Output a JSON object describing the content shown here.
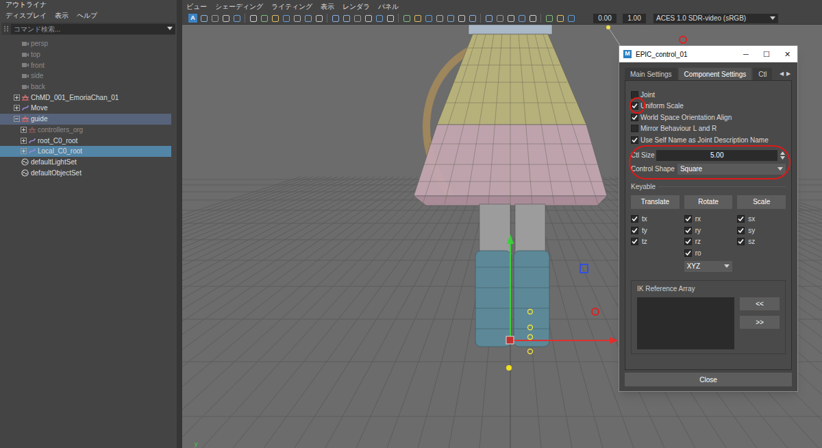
{
  "outliner": {
    "title": "アウトライナ",
    "menu": [
      "ディスプレイ",
      "表示",
      "ヘルプ"
    ],
    "search": {
      "placeholder": "コマンド検索..."
    },
    "items": [
      {
        "label": "persp",
        "kind": "camera",
        "depth": 0,
        "expandable": false,
        "expanded": false,
        "dimmed": true,
        "highlighted": false,
        "selected": false
      },
      {
        "label": "top",
        "kind": "camera",
        "depth": 0,
        "expandable": false,
        "expanded": false,
        "dimmed": true,
        "highlighted": false,
        "selected": false
      },
      {
        "label": "front",
        "kind": "camera",
        "depth": 0,
        "expandable": false,
        "expanded": false,
        "dimmed": true,
        "highlighted": false,
        "selected": false
      },
      {
        "label": "side",
        "kind": "camera",
        "depth": 0,
        "expandable": false,
        "expanded": false,
        "dimmed": true,
        "highlighted": false,
        "selected": false
      },
      {
        "label": "back",
        "kind": "camera",
        "depth": 0,
        "expandable": false,
        "expanded": false,
        "dimmed": true,
        "highlighted": false,
        "selected": false
      },
      {
        "label": "ChMD_001_EmoriaChan_01",
        "kind": "group",
        "depth": 0,
        "expandable": true,
        "expanded": false,
        "dimmed": false,
        "highlighted": false,
        "selected": false
      },
      {
        "label": "Move",
        "kind": "curve",
        "depth": 0,
        "expandable": true,
        "expanded": false,
        "dimmed": false,
        "highlighted": false,
        "selected": false
      },
      {
        "label": "guide",
        "kind": "group",
        "depth": 0,
        "expandable": true,
        "expanded": true,
        "dimmed": false,
        "highlighted": true,
        "selected": false
      },
      {
        "label": "controllers_org",
        "kind": "group",
        "depth": 1,
        "expandable": true,
        "expanded": false,
        "dimmed": true,
        "highlighted": false,
        "selected": false
      },
      {
        "label": "root_C0_root",
        "kind": "curve",
        "depth": 1,
        "expandable": true,
        "expanded": false,
        "dimmed": false,
        "highlighted": false,
        "selected": false
      },
      {
        "label": "Local_C0_root",
        "kind": "curve",
        "depth": 1,
        "expandable": true,
        "expanded": false,
        "dimmed": false,
        "highlighted": false,
        "selected": true
      },
      {
        "label": "defaultLightSet",
        "kind": "set",
        "depth": 0,
        "expandable": false,
        "expanded": false,
        "dimmed": false,
        "highlighted": false,
        "selected": false
      },
      {
        "label": "defaultObjectSet",
        "kind": "set",
        "depth": 0,
        "expandable": false,
        "expanded": false,
        "dimmed": false,
        "highlighted": false,
        "selected": false
      }
    ]
  },
  "viewport": {
    "menu": [
      "ビュー",
      "シェーディング",
      "ライティング",
      "表示",
      "レンダラ",
      "パネル"
    ],
    "toolbar_badge": "A",
    "fields": [
      "0.00",
      "1.00"
    ],
    "color_space": "ACES 1.0 SDR-video (sRGB)",
    "axis_label": "y"
  },
  "dialog": {
    "title": "EPIC_control_01",
    "app_icon": "M",
    "window_buttons": [
      "─",
      "☐",
      "✕"
    ],
    "tabs": [
      {
        "label": "Main Settings",
        "selected": false
      },
      {
        "label": "Component Settings",
        "selected": true
      },
      {
        "label": "Ctl",
        "selected": false
      }
    ],
    "tab_scroll": [
      "◀",
      "▶"
    ],
    "options": [
      {
        "label": "Joint",
        "checked": false
      },
      {
        "label": "Uniform Scale",
        "checked": true
      },
      {
        "label": "World Space Orientation Align",
        "checked": true
      },
      {
        "label": "Mirror Behaviour L and R",
        "checked": false
      },
      {
        "label": "Use Self Name as Joint Description Name",
        "checked": true
      }
    ],
    "ctl_size": {
      "label": "Ctl Size",
      "value": "5.00"
    },
    "control_shape": {
      "label": "Control Shape",
      "value": "Square"
    },
    "keyable": {
      "title": "Keyable",
      "groups": [
        {
          "button": "Translate",
          "channels": [
            {
              "label": "tx",
              "checked": true
            },
            {
              "label": "ty",
              "checked": true
            },
            {
              "label": "tz",
              "checked": true
            }
          ]
        },
        {
          "button": "Rotate",
          "channels": [
            {
              "label": "rx",
              "checked": true
            },
            {
              "label": "ry",
              "checked": true
            },
            {
              "label": "rz",
              "checked": true
            },
            {
              "label": "ro",
              "checked": true
            }
          ],
          "dropdown": "XYZ"
        },
        {
          "button": "Scale",
          "channels": [
            {
              "label": "sx",
              "checked": true
            },
            {
              "label": "sy",
              "checked": true
            },
            {
              "label": "sz",
              "checked": true
            }
          ]
        }
      ]
    },
    "ik_reference": {
      "title": "IK Reference Array",
      "buttons": [
        "<<",
        ">>"
      ]
    },
    "close": "Close"
  }
}
